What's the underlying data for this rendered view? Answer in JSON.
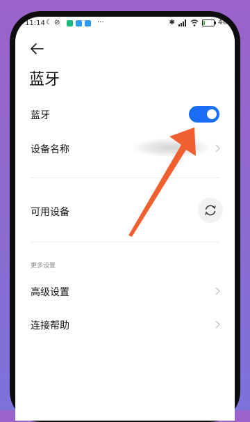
{
  "status_bar": {
    "time": "11:14",
    "battery_text": "4",
    "battery_unit": "%",
    "battery_level": 0.04
  },
  "page": {
    "title": "蓝牙"
  },
  "settings": {
    "bluetooth_label": "蓝牙",
    "bluetooth_on": true,
    "device_name_label": "设备名称",
    "available_devices_label": "可用设备",
    "more_settings_header": "更多设置",
    "advanced_label": "高级设置",
    "help_label": "连接帮助"
  },
  "colors": {
    "toggle_on": "#1a6ef5",
    "annotation_arrow": "#ee6030",
    "background_gradient_top": "#9a63c9",
    "background_gradient_bottom": "#7c73d9"
  },
  "icons": [
    "moon-icon",
    "do-not-disturb-icon",
    "app-notification-icon",
    "more-icon",
    "bluetooth-icon",
    "signal-icon",
    "wifi-icon",
    "battery-icon",
    "back-arrow-icon",
    "chevron-right-icon",
    "refresh-icon"
  ]
}
